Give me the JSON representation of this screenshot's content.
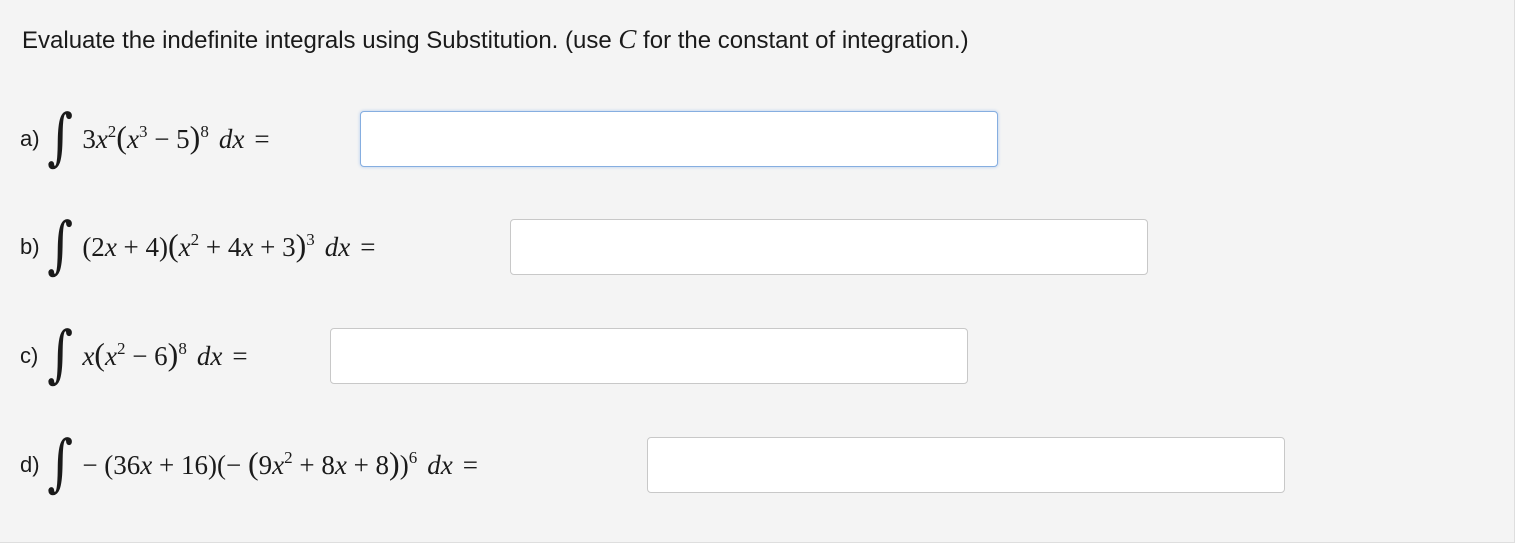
{
  "instructions": {
    "prefix": "Evaluate the indefinite integrals using Substitution. (use ",
    "constant_symbol": "C",
    "suffix": " for the constant of integration.)"
  },
  "problems": [
    {
      "label": "a)",
      "integrand": "3x²(x³ − 5)⁸",
      "differential": "dx",
      "equals": "=",
      "answer_value": "",
      "focused": true
    },
    {
      "label": "b)",
      "integrand": "(2x + 4)(x² + 4x + 3)³",
      "differential": "dx",
      "equals": "=",
      "answer_value": "",
      "focused": false
    },
    {
      "label": "c)",
      "integrand": "x(x² − 6)⁸",
      "differential": "dx",
      "equals": "=",
      "answer_value": "",
      "focused": false
    },
    {
      "label": "d)",
      "integrand": "− (36x + 16)(− (9x² + 8x + 8))⁶",
      "differential": "dx",
      "equals": "=",
      "answer_value": "",
      "focused": false
    }
  ],
  "colors": {
    "background": "#f4f4f4",
    "input_border": "#c8c8c8",
    "input_focus_border": "#86aee0",
    "text": "#1a1a1a"
  }
}
